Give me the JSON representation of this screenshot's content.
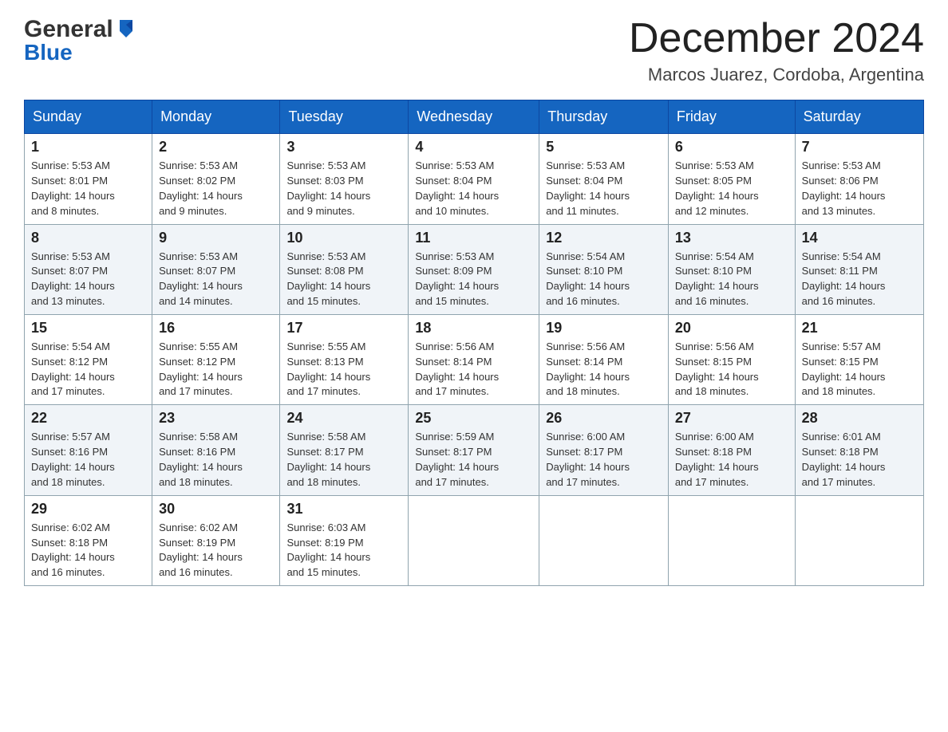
{
  "header": {
    "logo_general": "General",
    "logo_blue": "Blue",
    "month_title": "December 2024",
    "location": "Marcos Juarez, Cordoba, Argentina"
  },
  "days_of_week": [
    "Sunday",
    "Monday",
    "Tuesday",
    "Wednesday",
    "Thursday",
    "Friday",
    "Saturday"
  ],
  "weeks": [
    [
      {
        "day": "1",
        "sunrise": "5:53 AM",
        "sunset": "8:01 PM",
        "daylight": "14 hours and 8 minutes."
      },
      {
        "day": "2",
        "sunrise": "5:53 AM",
        "sunset": "8:02 PM",
        "daylight": "14 hours and 9 minutes."
      },
      {
        "day": "3",
        "sunrise": "5:53 AM",
        "sunset": "8:03 PM",
        "daylight": "14 hours and 9 minutes."
      },
      {
        "day": "4",
        "sunrise": "5:53 AM",
        "sunset": "8:04 PM",
        "daylight": "14 hours and 10 minutes."
      },
      {
        "day": "5",
        "sunrise": "5:53 AM",
        "sunset": "8:04 PM",
        "daylight": "14 hours and 11 minutes."
      },
      {
        "day": "6",
        "sunrise": "5:53 AM",
        "sunset": "8:05 PM",
        "daylight": "14 hours and 12 minutes."
      },
      {
        "day": "7",
        "sunrise": "5:53 AM",
        "sunset": "8:06 PM",
        "daylight": "14 hours and 13 minutes."
      }
    ],
    [
      {
        "day": "8",
        "sunrise": "5:53 AM",
        "sunset": "8:07 PM",
        "daylight": "14 hours and 13 minutes."
      },
      {
        "day": "9",
        "sunrise": "5:53 AM",
        "sunset": "8:07 PM",
        "daylight": "14 hours and 14 minutes."
      },
      {
        "day": "10",
        "sunrise": "5:53 AM",
        "sunset": "8:08 PM",
        "daylight": "14 hours and 15 minutes."
      },
      {
        "day": "11",
        "sunrise": "5:53 AM",
        "sunset": "8:09 PM",
        "daylight": "14 hours and 15 minutes."
      },
      {
        "day": "12",
        "sunrise": "5:54 AM",
        "sunset": "8:10 PM",
        "daylight": "14 hours and 16 minutes."
      },
      {
        "day": "13",
        "sunrise": "5:54 AM",
        "sunset": "8:10 PM",
        "daylight": "14 hours and 16 minutes."
      },
      {
        "day": "14",
        "sunrise": "5:54 AM",
        "sunset": "8:11 PM",
        "daylight": "14 hours and 16 minutes."
      }
    ],
    [
      {
        "day": "15",
        "sunrise": "5:54 AM",
        "sunset": "8:12 PM",
        "daylight": "14 hours and 17 minutes."
      },
      {
        "day": "16",
        "sunrise": "5:55 AM",
        "sunset": "8:12 PM",
        "daylight": "14 hours and 17 minutes."
      },
      {
        "day": "17",
        "sunrise": "5:55 AM",
        "sunset": "8:13 PM",
        "daylight": "14 hours and 17 minutes."
      },
      {
        "day": "18",
        "sunrise": "5:56 AM",
        "sunset": "8:14 PM",
        "daylight": "14 hours and 17 minutes."
      },
      {
        "day": "19",
        "sunrise": "5:56 AM",
        "sunset": "8:14 PM",
        "daylight": "14 hours and 18 minutes."
      },
      {
        "day": "20",
        "sunrise": "5:56 AM",
        "sunset": "8:15 PM",
        "daylight": "14 hours and 18 minutes."
      },
      {
        "day": "21",
        "sunrise": "5:57 AM",
        "sunset": "8:15 PM",
        "daylight": "14 hours and 18 minutes."
      }
    ],
    [
      {
        "day": "22",
        "sunrise": "5:57 AM",
        "sunset": "8:16 PM",
        "daylight": "14 hours and 18 minutes."
      },
      {
        "day": "23",
        "sunrise": "5:58 AM",
        "sunset": "8:16 PM",
        "daylight": "14 hours and 18 minutes."
      },
      {
        "day": "24",
        "sunrise": "5:58 AM",
        "sunset": "8:17 PM",
        "daylight": "14 hours and 18 minutes."
      },
      {
        "day": "25",
        "sunrise": "5:59 AM",
        "sunset": "8:17 PM",
        "daylight": "14 hours and 17 minutes."
      },
      {
        "day": "26",
        "sunrise": "6:00 AM",
        "sunset": "8:17 PM",
        "daylight": "14 hours and 17 minutes."
      },
      {
        "day": "27",
        "sunrise": "6:00 AM",
        "sunset": "8:18 PM",
        "daylight": "14 hours and 17 minutes."
      },
      {
        "day": "28",
        "sunrise": "6:01 AM",
        "sunset": "8:18 PM",
        "daylight": "14 hours and 17 minutes."
      }
    ],
    [
      {
        "day": "29",
        "sunrise": "6:02 AM",
        "sunset": "8:18 PM",
        "daylight": "14 hours and 16 minutes."
      },
      {
        "day": "30",
        "sunrise": "6:02 AM",
        "sunset": "8:19 PM",
        "daylight": "14 hours and 16 minutes."
      },
      {
        "day": "31",
        "sunrise": "6:03 AM",
        "sunset": "8:19 PM",
        "daylight": "14 hours and 15 minutes."
      },
      null,
      null,
      null,
      null
    ]
  ],
  "labels": {
    "sunrise": "Sunrise:",
    "sunset": "Sunset:",
    "daylight": "Daylight:"
  }
}
